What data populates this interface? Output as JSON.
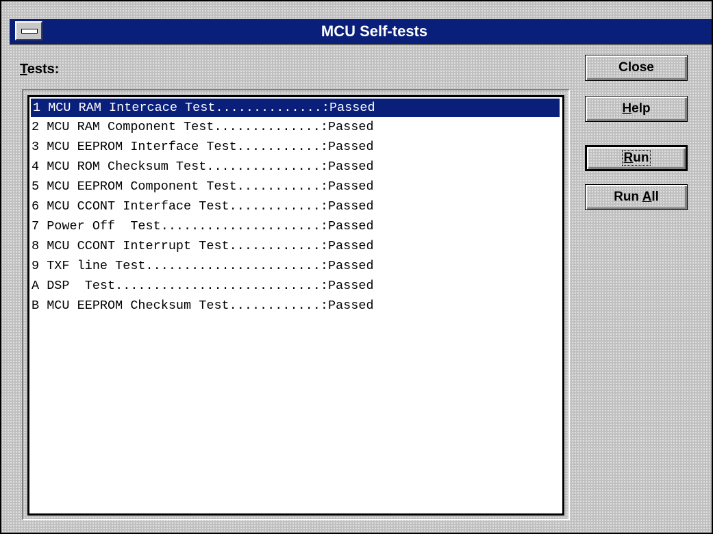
{
  "window": {
    "title": "MCU Self-tests"
  },
  "tests_label": {
    "accel": "T",
    "rest": "ests:"
  },
  "tests": [
    "1 MCU RAM Intercace Test..............:Passed",
    "2 MCU RAM Component Test..............:Passed",
    "3 MCU EEPROM Interface Test...........:Passed",
    "4 MCU ROM Checksum Test...............:Passed",
    "5 MCU EEPROM Component Test...........:Passed",
    "6 MCU CCONT Interface Test............:Passed",
    "7 Power Off  Test.....................:Passed",
    "8 MCU CCONT Interrupt Test............:Passed",
    "9 TXF line Test.......................:Passed",
    "A DSP  Test...........................:Passed",
    "B MCU EEPROM Checksum Test............:Passed"
  ],
  "selected_index": 0,
  "buttons": {
    "close": {
      "pre": "Close",
      "accel": "",
      "post": ""
    },
    "help": {
      "pre": "",
      "accel": "H",
      "post": "elp"
    },
    "run": {
      "pre": "",
      "accel": "R",
      "post": "un"
    },
    "run_all": {
      "pre": "Run ",
      "accel": "A",
      "post": "ll"
    }
  },
  "colors": {
    "title_bar": "#0a1f7a",
    "selection": "#0a1f7a",
    "face": "#c0c0c0"
  }
}
